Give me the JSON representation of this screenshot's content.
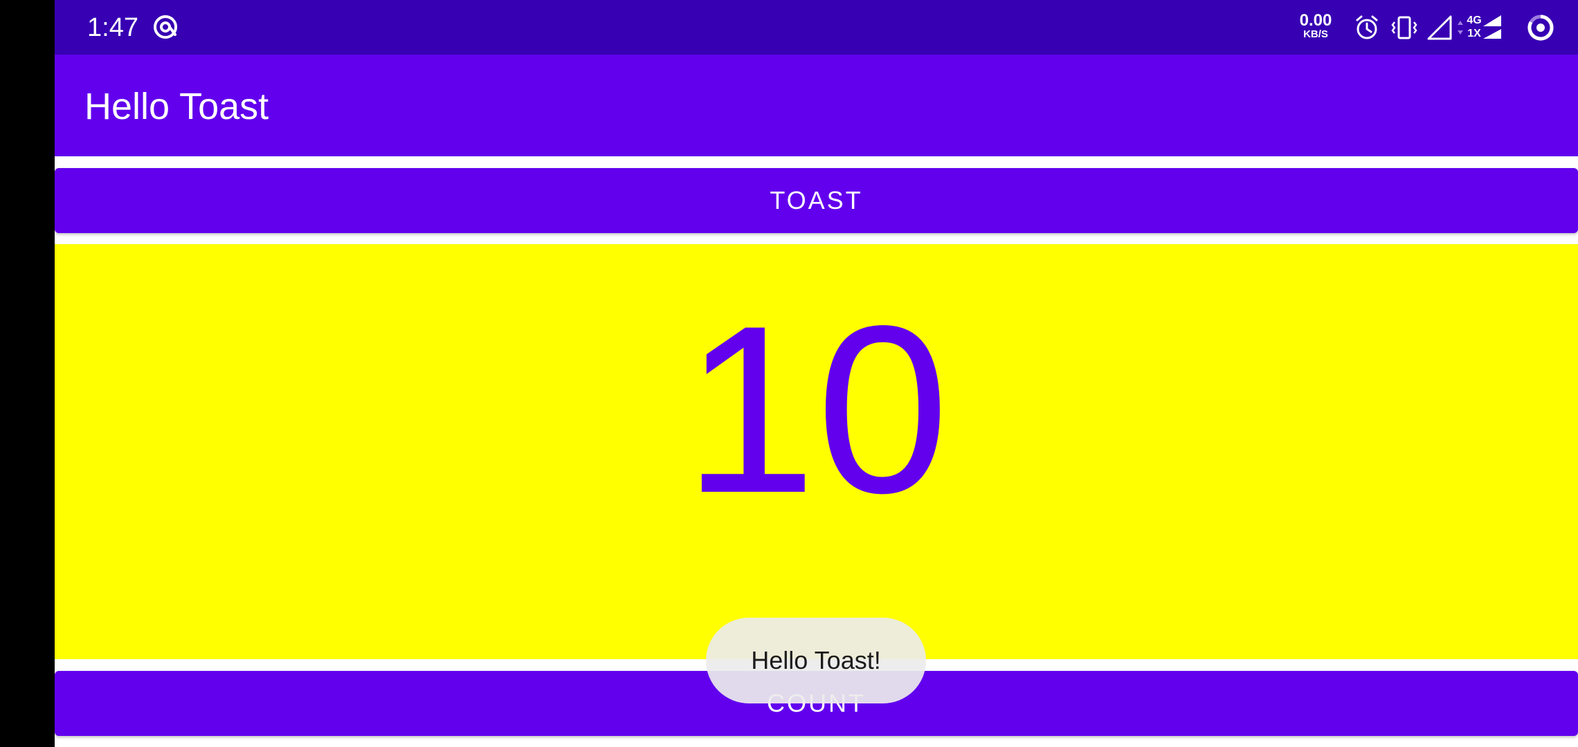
{
  "status_bar": {
    "time": "1:47",
    "net_speed_value": "0.00",
    "net_speed_unit": "KB/S",
    "network_type": "4G",
    "sim_slot": "1X",
    "icons": [
      "cast-at-icon",
      "alarm-icon",
      "vibrate-icon",
      "signal-icon",
      "data-arrows-icon",
      "signal-4g-icon",
      "battery-ring-icon"
    ]
  },
  "app_bar": {
    "title": "Hello Toast"
  },
  "toast_button": {
    "label": "TOAST"
  },
  "counter": {
    "value": "10"
  },
  "count_button": {
    "label": "COUNT"
  },
  "toast_message": {
    "text": "Hello Toast!"
  },
  "colors": {
    "status_bar": "#3700b3",
    "primary": "#6200ee",
    "counter_background": "#ffff00",
    "toast_background": "#ececec",
    "text_on_primary": "#ffffff"
  }
}
